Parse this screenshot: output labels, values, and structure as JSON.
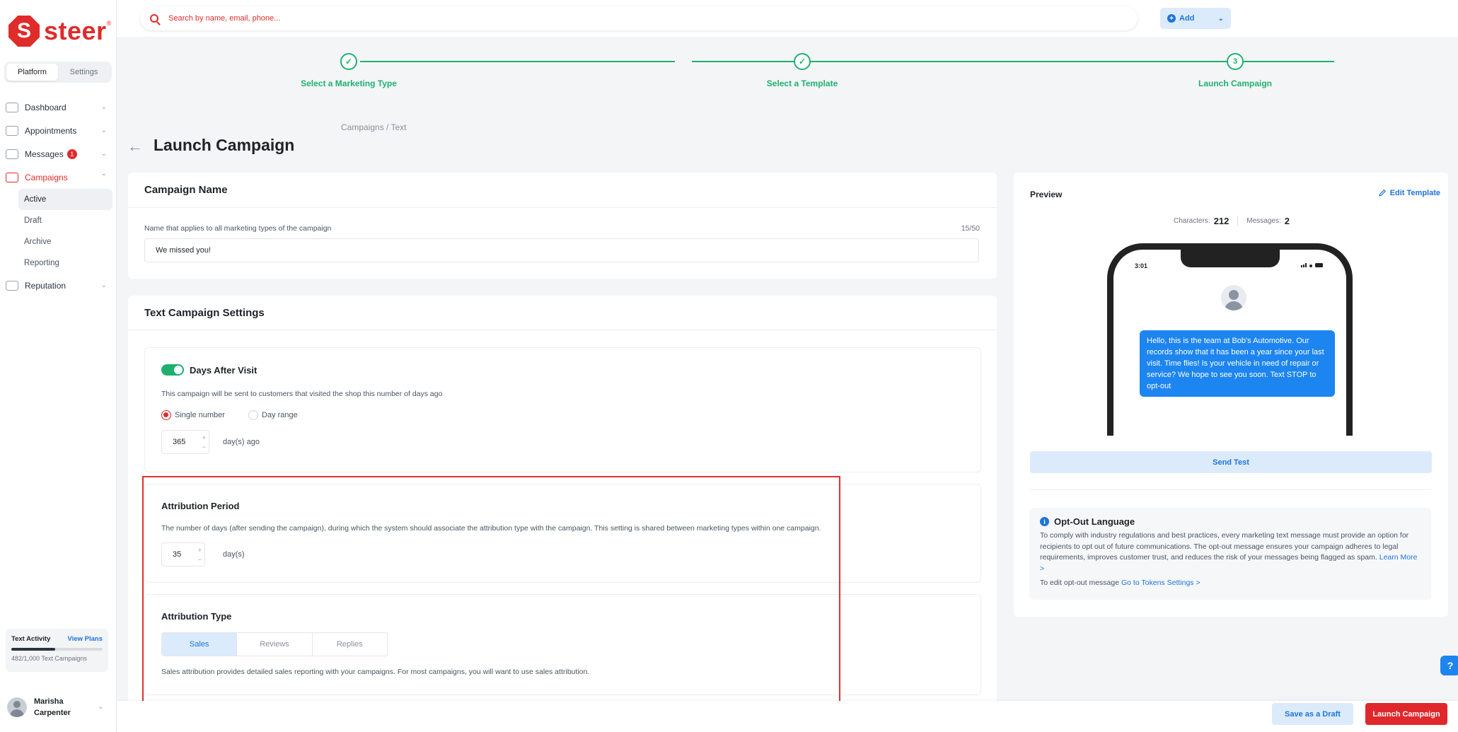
{
  "brand": {
    "name": "steer",
    "logo_letter": "S",
    "color": "#e02b2b"
  },
  "sidebar": {
    "segments": [
      "Platform",
      "Settings"
    ],
    "active_segment": "Platform",
    "items": [
      {
        "label": "Dashboard",
        "icon": "dashboard-icon"
      },
      {
        "label": "Appointments",
        "icon": "calendar-icon"
      },
      {
        "label": "Messages",
        "icon": "messages-icon",
        "badge": "1"
      },
      {
        "label": "Campaigns",
        "icon": "megaphone-icon"
      },
      {
        "label": "Reputation",
        "icon": "reputation-icon"
      }
    ],
    "campaign_sub": [
      "Active",
      "Draft",
      "Archive",
      "Reporting"
    ],
    "text_activity": {
      "title": "Text Activity",
      "link": "View Plans",
      "usage": "482/1,000 Text Campaigns",
      "fraction": 0.482
    },
    "user": {
      "name": "Marisha Carpenter"
    }
  },
  "topbar": {
    "search_placeholder": "Search by name, email, phone...",
    "add_label": "Add"
  },
  "stepper": {
    "steps": [
      {
        "label": "Select a Marketing Type",
        "state": "done"
      },
      {
        "label": "Select a Template",
        "state": "done"
      },
      {
        "label": "Launch Campaign",
        "state": "current",
        "number": "3"
      }
    ]
  },
  "breadcrumb": "Campaigns / Text",
  "page_title": "Launch Campaign",
  "campaign_name": {
    "title": "Campaign Name",
    "label": "Name that applies to all marketing types of the campaign",
    "counter": "15/50",
    "value": "We missed you!"
  },
  "settings": {
    "title": "Text Campaign Settings",
    "days_after_visit": {
      "title": "Days After Visit",
      "enabled": true,
      "desc": "This campaign will be sent to customers that visited the shop this number of days ago",
      "options": [
        "Single number",
        "Day range"
      ],
      "selected": "Single number",
      "value": "365",
      "unit": "day(s) ago"
    },
    "attribution_period": {
      "title": "Attribution Period",
      "desc": "The number of days (after sending the campaign), during which the system should associate the attribution type with the campaign. This setting is shared between marketing types within one campaign.",
      "value": "35",
      "unit": "day(s)"
    },
    "attribution_type": {
      "title": "Attribution Type",
      "tabs": [
        "Sales",
        "Reviews",
        "Replies"
      ],
      "selected": "Sales",
      "desc": "Sales attribution provides detailed sales reporting with your campaigns. For most campaigns, you will want to use sales attribution."
    }
  },
  "preview": {
    "title": "Preview",
    "edit_label": "Edit Template",
    "characters_label": "Characters:",
    "characters": "212",
    "messages_label": "Messages:",
    "messages": "2",
    "phone_time": "3:01",
    "message": "Hello, this is the team at Bob's Automotive. Our records show that it has been a year since your last visit. Time flies! Is your vehicle in need of repair or service? We hope to see you soon. Text STOP to opt-out",
    "send_test": "Send Test"
  },
  "optout": {
    "title": "Opt-Out Language",
    "body": "To comply with industry regulations and best practices, every marketing text message must provide an option for recipients to opt out of future communications. The opt-out message ensures your campaign adheres to legal requirements, improves customer trust, and reduces the risk of your messages being flagged as spam.",
    "learn_more": "Learn More >",
    "edit_prefix": "To edit opt-out message",
    "edit_link": "Go to Tokens Settings >"
  },
  "footer": {
    "save_draft": "Save as a Draft",
    "launch": "Launch Campaign"
  },
  "colors": {
    "accent": "#1d74d8",
    "success": "#1eb16d",
    "danger": "#e02b2b"
  }
}
